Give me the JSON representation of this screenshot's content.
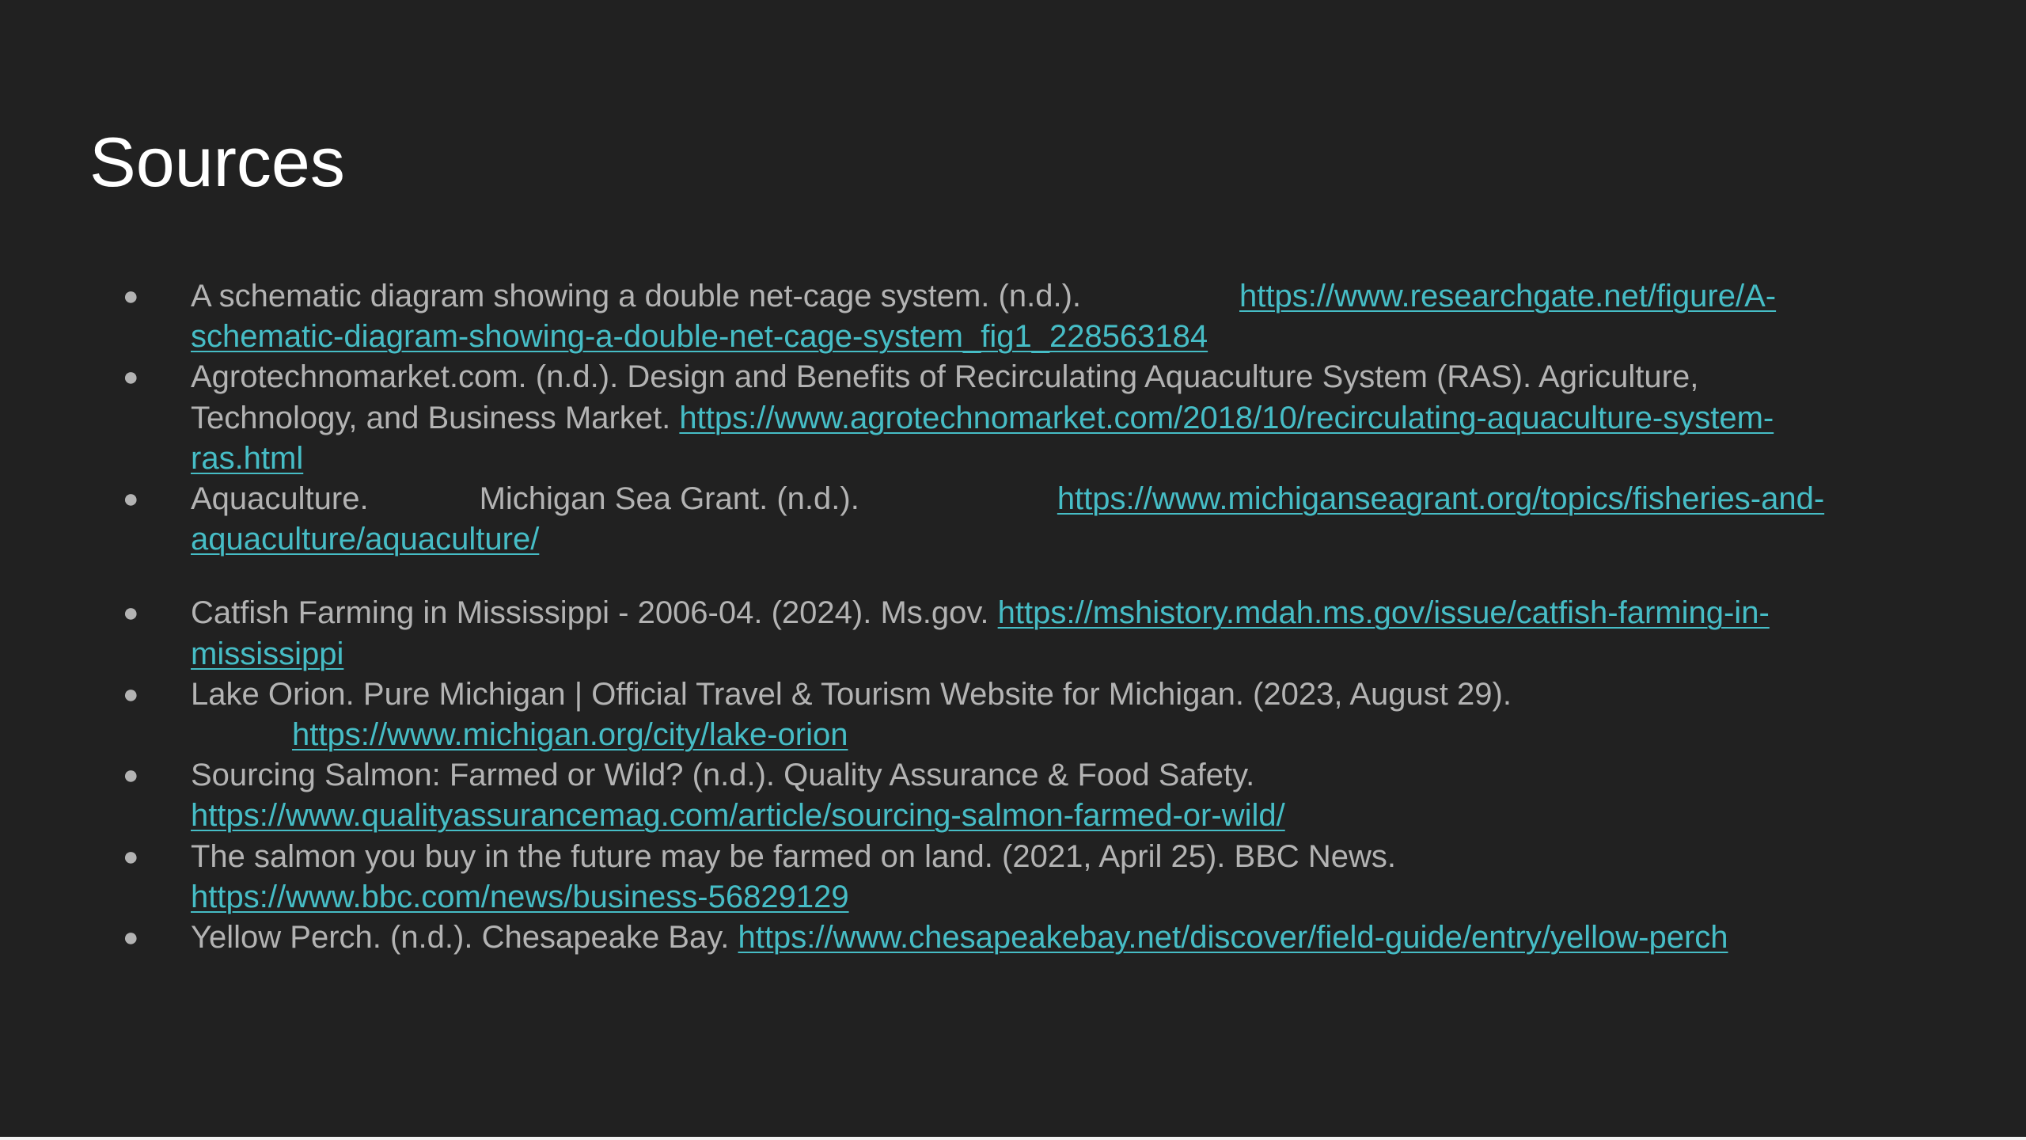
{
  "slide": {
    "title": "Sources",
    "items": [
      {
        "text": "A schematic diagram showing a double net-cage system. (n.d.).",
        "url_line1": "https://www.researchgate.net/figure/A-",
        "url_line2": "schematic-diagram-showing-a-double-net-cage-system_fig1_228563184"
      },
      {
        "text_line1": "Agrotechnomarket.com. (n.d.). Design and Benefits of Recirculating Aquaculture System (RAS). Agriculture,",
        "text_line2": "Technology, and Business Market.",
        "url_line1": "https://www.agrotechnomarket.com/2018/10/recirculating-aquaculture-system-",
        "url_line2": "ras.html"
      },
      {
        "text_part1": "Aquaculture.",
        "text_part2": "Michigan Sea Grant. (n.d.).",
        "url_line1": "https://www.michiganseagrant.org/topics/fisheries-and-",
        "url_line2": "aquaculture/aquaculture/"
      },
      {
        "text": "Catfish Farming in Mississippi - 2006-04. (2024). Ms.gov.",
        "url_line1": "https://mshistory.mdah.ms.gov/issue/catfish-farming-in-",
        "url_line2": "mississippi"
      },
      {
        "text": "Lake Orion. Pure Michigan | Official Travel & Tourism Website for Michigan. (2023, August 29).",
        "url": "https://www.michigan.org/city/lake-orion"
      },
      {
        "text": "Sourcing Salmon: Farmed or Wild? (n.d.). Quality Assurance & Food Safety.",
        "url": "https://www.qualityassurancemag.com/article/sourcing-salmon-farmed-or-wild/"
      },
      {
        "text": "The salmon you buy in the future may be farmed on land. (2021, April 25). BBC News.",
        "url": "https://www.bbc.com/news/business-56829129"
      },
      {
        "text": "Yellow Perch. (n.d.). Chesapeake Bay.",
        "url": "https://www.chesapeakebay.net/discover/field-guide/entry/yellow-perch"
      }
    ]
  }
}
